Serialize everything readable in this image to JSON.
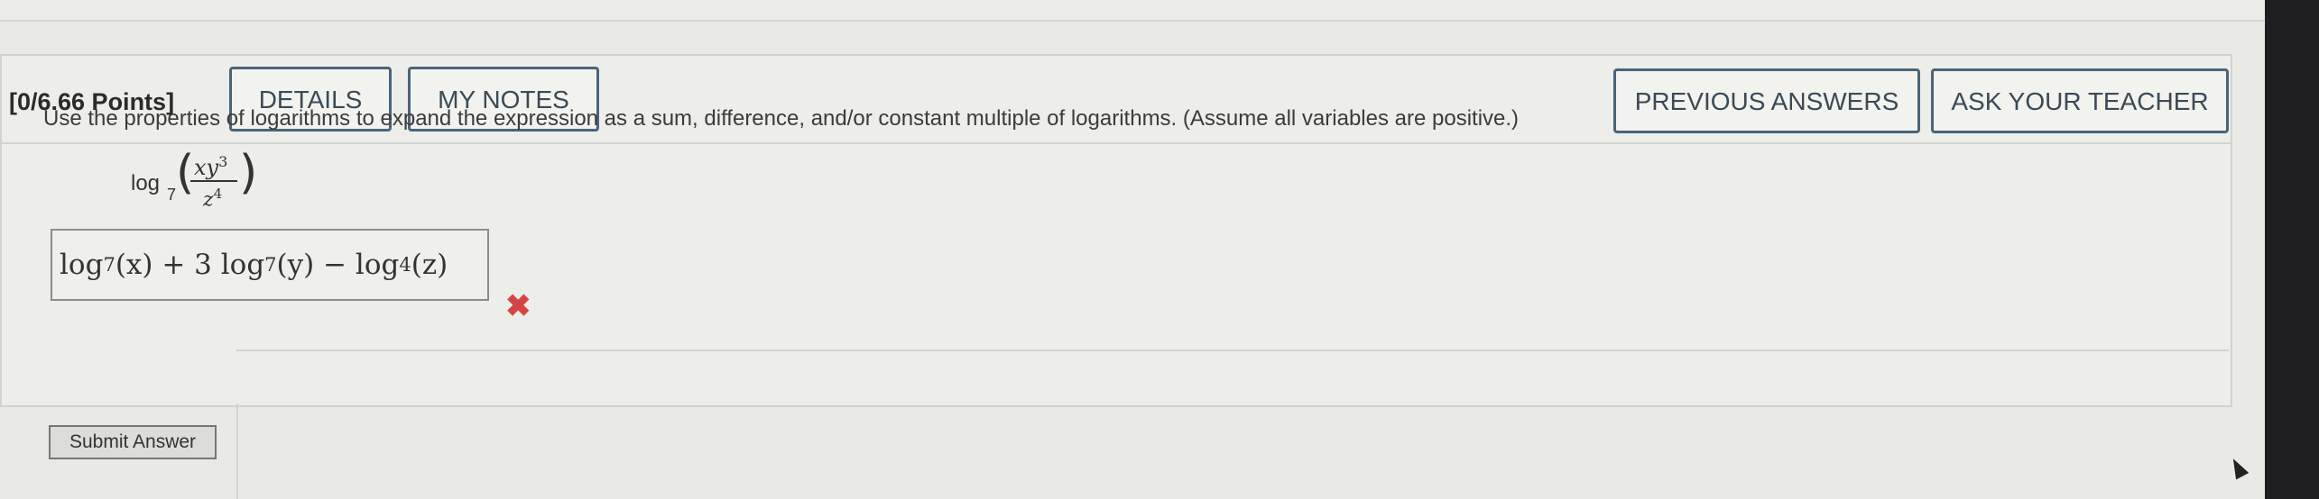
{
  "points_label": "[0/6.66 Points]",
  "buttons": {
    "details": "DETAILS",
    "my_notes": "MY NOTES",
    "previous_answers": "PREVIOUS ANSWERS",
    "ask_teacher": "ASK YOUR TEACHER"
  },
  "problem": {
    "instruction": "Use the properties of logarithms to expand the expression as a sum, difference, and/or constant multiple of logarithms. (Assume all variables are positive.)",
    "expression": {
      "log": "log",
      "base": "7",
      "numerator_base": "xy",
      "numerator_exp": "3",
      "denominator_base": "z",
      "denominator_exp": "4"
    }
  },
  "answer": {
    "t1": "log",
    "b1": "7",
    "a1": "(x) + 3 log",
    "b2": "7",
    "a2": "(y) − log",
    "b3": "4",
    "a3": "(z)",
    "status_icon": "x-mark-icon",
    "status_color": "#d64545"
  },
  "submit_label": "Submit Answer"
}
